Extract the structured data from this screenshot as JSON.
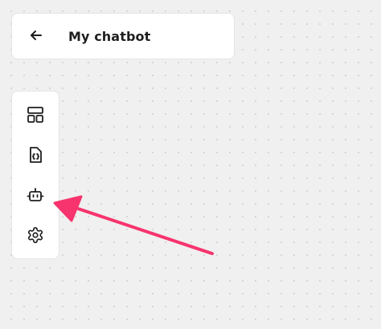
{
  "header": {
    "title": "My chatbot",
    "back_icon": "arrow-left-icon"
  },
  "sidebar": {
    "items": [
      {
        "name": "layout",
        "icon": "layout-grid-icon"
      },
      {
        "name": "code-file",
        "icon": "file-code-icon"
      },
      {
        "name": "bot",
        "icon": "bot-icon"
      },
      {
        "name": "settings",
        "icon": "gear-icon"
      }
    ]
  },
  "annotation": {
    "type": "arrow",
    "color": "#f7346e",
    "target": "sidebar-item-bot"
  },
  "colors": {
    "background": "#f0f0f0",
    "card": "#ffffff",
    "text": "#1e1e1e",
    "arrow": "#f7346e"
  }
}
